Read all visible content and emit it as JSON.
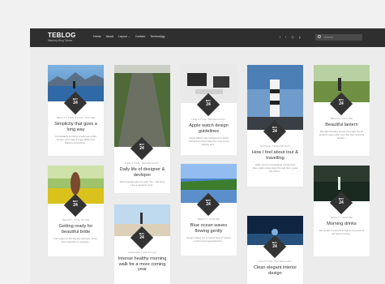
{
  "header": {
    "logo": "TEBLOG",
    "tagline": "Masonry Blog Theme",
    "nav": [
      "Home",
      "About",
      "Layout ⌄",
      "Contact",
      "Technology"
    ],
    "social_icons": [
      "facebook-icon",
      "twitter-icon",
      "instagram-icon",
      "pinterest-icon"
    ],
    "search_placeholder": "Search"
  },
  "badge": {
    "month": "MAY",
    "day": "24"
  },
  "posts": [
    {
      "category": "BEAUTY, LIFE STYLE, NATURE",
      "title": "Simplicity that goes a long way",
      "excerpt": "Immediately knowing a task just a little simpler can make a huge difference. Making something..."
    },
    {
      "category": "LIFE STYLE, TECHNOLOGY",
      "title": "Apple watch design guidelines",
      "excerpt": "Apple Watch was designed for quick interactions that make the most of the display and..."
    },
    {
      "category": "BEAUTY, NATURE",
      "title": "Beautiful lantern",
      "excerpt": "Wonders flowing across the night sky as lanterns glow softly over the river and drift quietly..."
    },
    {
      "category": "LIFE STYLE, TECHNOLOGY",
      "title": "Daily life of designer & devloper",
      "excerpt": "When people ask me what I do, I tell them I am a designer and..."
    },
    {
      "category": "NATURE, TECHNOLOGY",
      "title": "How I feel about tour & travelling",
      "excerpt": "Often found in thousands of historical sites, paths trace back through time, gives the travel..."
    },
    {
      "category": "BEAUTY, LIFE STYLE",
      "title": "Getting ready for beautiful bride",
      "excerpt": "Get ready for the big day with tips, tricks, and inspiration to prepare..."
    },
    {
      "category": "BEAUTY, NATURE",
      "title": "Blue ocean waves flowing gently",
      "excerpt": "Ocean waves are a typical type of marine environment generated by..."
    },
    {
      "category": "BEAUTY, NATURE",
      "title": "Morning drinks",
      "excerpt": "We spoke to experts to figure out some of the best morning..."
    },
    {
      "category": "FASHION, LIFE STYLE",
      "title": "Intense healthy morning walk for a more coming year",
      "excerpt": ""
    },
    {
      "category": "LIFE STYLE, TECHNOLOGY",
      "title": "Clean elegant interior design",
      "excerpt": ""
    }
  ]
}
